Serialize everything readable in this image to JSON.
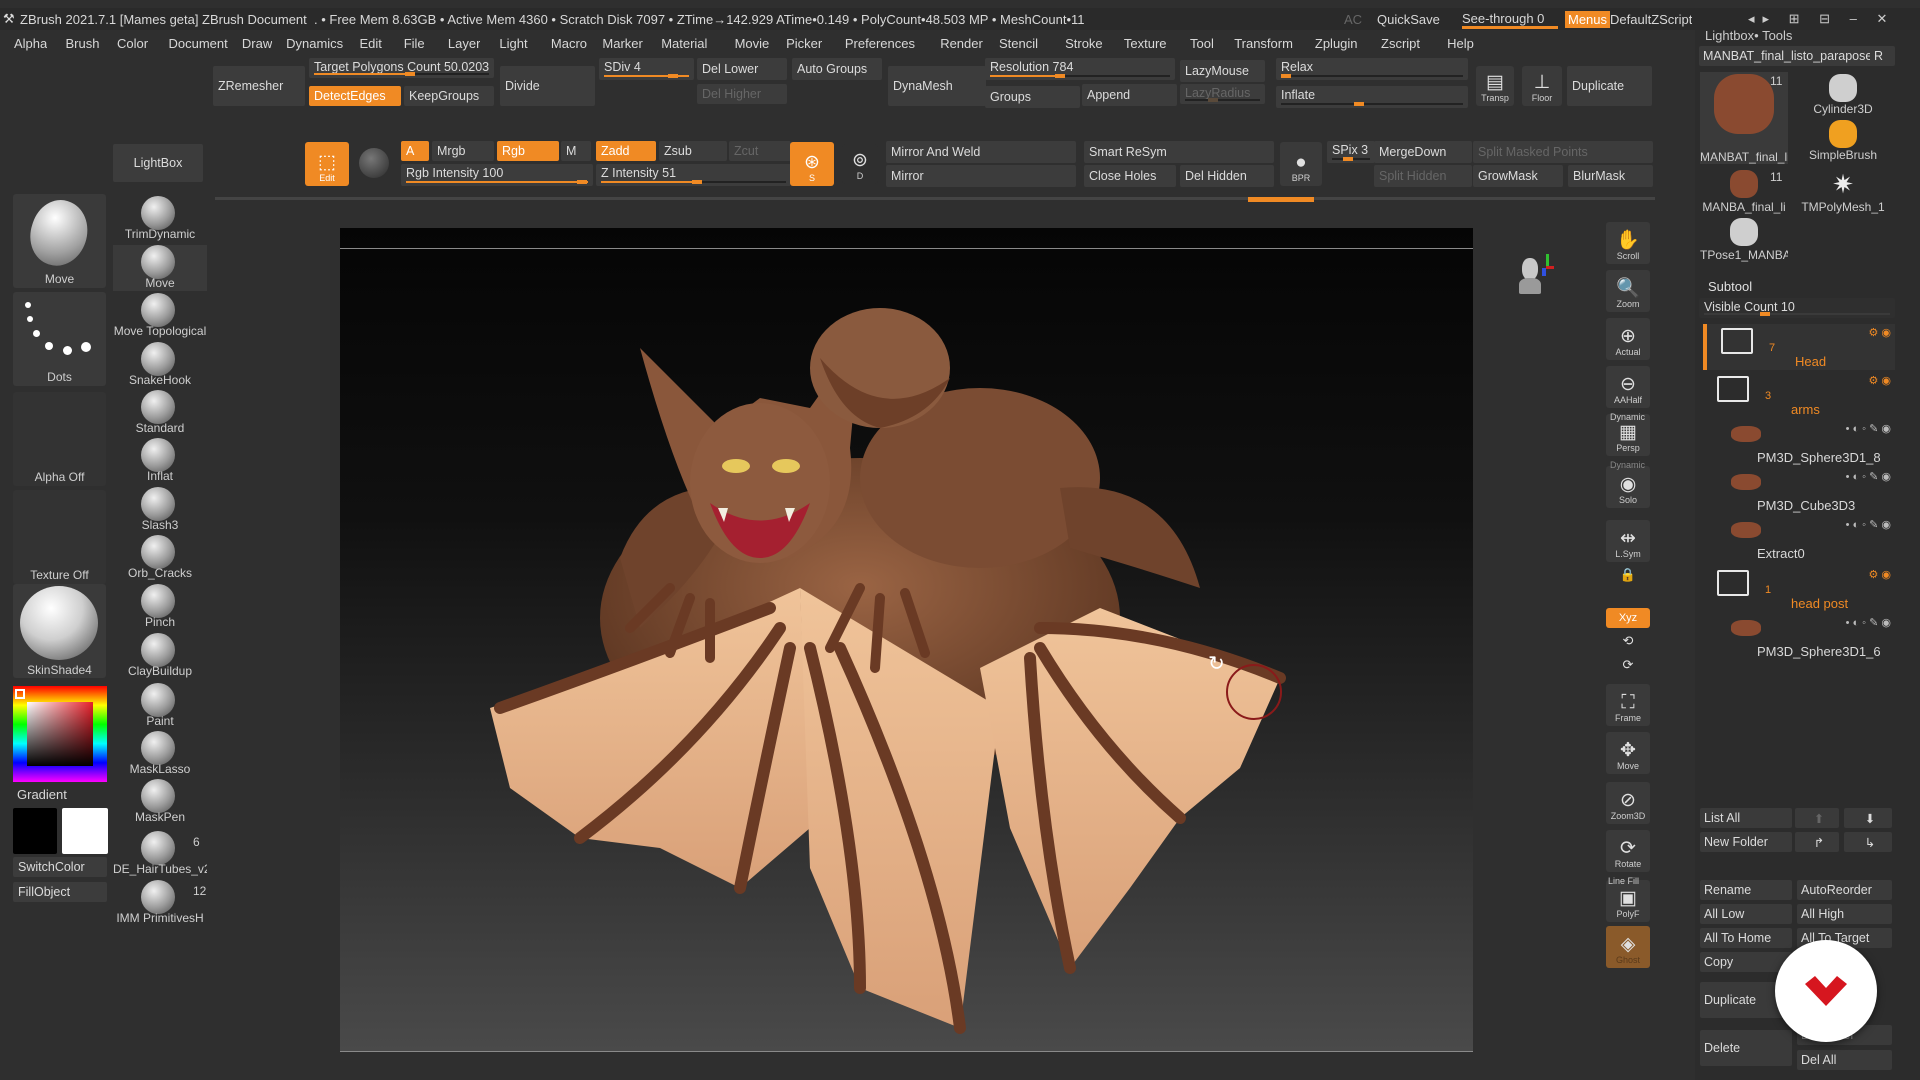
{
  "titlebar": {
    "app": "ZBrush 2021.7.1 [Mames geta]",
    "doc": "ZBrush Document",
    "stats": ". • Free Mem 8.63GB • Active Mem 4360 • Scratch Disk 7097 • ZTime→142.929 ATime•0.149 • PolyCount•48.503 MP • MeshCount•11",
    "ac": "AC",
    "quicksave": "QuickSave",
    "see_through": "See-through  0",
    "menus": "Menus",
    "script": "DefaultZScript"
  },
  "menubar": [
    "Alpha",
    "Brush",
    "Color",
    "Document",
    "Draw",
    "Dynamics",
    "Edit",
    "File",
    "Layer",
    "Light",
    "Macro",
    "Marker",
    "Material",
    "Movie",
    "Picker",
    "Preferences",
    "Render",
    "Stencil",
    "Stroke",
    "Texture",
    "Tool",
    "Transform",
    "Zplugin",
    "Zscript",
    "Help"
  ],
  "topshelf": {
    "zremesher": "ZRemesher",
    "target_polys": "Target Polygons Count 50.0203",
    "detect_edges": "DetectEdges",
    "keep_groups": "KeepGroups",
    "divide": "Divide",
    "sdiv": "SDiv 4",
    "del_lower": "Del Lower",
    "del_higher": "Del Higher",
    "auto_groups": "Auto Groups",
    "dynamesh": "DynaMesh",
    "resolution": "Resolution 784",
    "groups": "Groups",
    "lazymouse": "LazyMouse",
    "lazyradius": "LazyRadius",
    "append": "Append",
    "relax": "Relax",
    "inflate": "Inflate",
    "transp": "Transp",
    "floor": "Floor",
    "duplicate": "Duplicate"
  },
  "toolbar2": {
    "lightbox": "LightBox",
    "edit": "Edit",
    "a": "A",
    "mrgb": "Mrgb",
    "rgb": "Rgb",
    "m": "M",
    "zadd": "Zadd",
    "zsub": "Zsub",
    "zcut": "Zcut",
    "rgb_intensity": "Rgb Intensity 100",
    "z_intensity": "Z Intensity 51",
    "mirror_weld": "Mirror And Weld",
    "mirror": "Mirror",
    "smart_resym": "Smart ReSym",
    "close_holes": "Close Holes",
    "del_hidden": "Del Hidden",
    "bpr": "BPR",
    "spix": "SPix 3",
    "mergedown": "MergeDown",
    "split_masked": "Split Masked Points",
    "split_hidden": "Split Hidden",
    "growmask": "GrowMask",
    "blurmask": "BlurMask",
    "s_label": "S",
    "d_label": "D"
  },
  "leftshelf": {
    "move": "Move",
    "dots": "Dots",
    "alpha_off": "Alpha Off",
    "texture_off": "Texture Off",
    "skinshade": "SkinShade4",
    "gradient": "Gradient",
    "switchcolor": "SwitchColor",
    "fillobject": "FillObject"
  },
  "brushes": [
    {
      "label": "TrimDynamic"
    },
    {
      "label": "Move"
    },
    {
      "label": "Move Topological"
    },
    {
      "label": "SnakeHook"
    },
    {
      "label": "Standard"
    },
    {
      "label": "Inflat"
    },
    {
      "label": "Slash3"
    },
    {
      "label": "Orb_Cracks"
    },
    {
      "label": "Pinch"
    },
    {
      "label": "ClayBuildup"
    },
    {
      "label": "Paint"
    },
    {
      "label": "MaskLasso"
    },
    {
      "label": "MaskPen"
    },
    {
      "label": "DE_HairTubes_v2",
      "count": "6"
    },
    {
      "label": "IMM PrimitivesH",
      "count": "12"
    }
  ],
  "rightshelf": [
    "Scroll",
    "Zoom",
    "Actual",
    "AAHalf",
    "Persp",
    "Solo",
    "L.Sym",
    "",
    "Xyz",
    "",
    "",
    "Frame",
    "Move",
    "Zoom3D",
    "Rotate",
    "PolyF",
    "Ghost"
  ],
  "rightshelf_labels": {
    "dynamic": "Dynamic",
    "dynamic2": "Dynamic",
    "linefill": "Line Fill"
  },
  "tools": {
    "header": "Lightbox• Tools",
    "current": "MANBAT_final_listo_parapose",
    "r": "R",
    "items": [
      {
        "label": "MANBAT_final_li",
        "count": "11"
      },
      {
        "label": "Cylinder3D"
      },
      {
        "label": "SimpleBrush"
      },
      {
        "label": "MANBA_final_li",
        "count": "11"
      },
      {
        "label": "TMPolyMesh_1"
      },
      {
        "label": "TPose1_MANBA"
      }
    ]
  },
  "subtool": {
    "title": "Subtool",
    "visible_count": "Visible Count 10",
    "rows": [
      {
        "type": "folder",
        "name": "Head",
        "count": "7"
      },
      {
        "type": "folder",
        "name": "arms",
        "count": "3"
      },
      {
        "type": "mesh",
        "name": "PM3D_Sphere3D1_8"
      },
      {
        "type": "mesh",
        "name": "PM3D_Cube3D3"
      },
      {
        "type": "mesh",
        "name": "Extract0"
      },
      {
        "type": "folder",
        "name": "head post",
        "count": "1"
      },
      {
        "type": "mesh",
        "name": "PM3D_Sphere3D1_6"
      }
    ],
    "list_all": "List All",
    "new_folder": "New Folder",
    "rename": "Rename",
    "autoreorder": "AutoReorder",
    "all_low": "All Low",
    "all_high": "All High",
    "all_to_home": "All To Home",
    "all_to_target": "All To Target",
    "copy": "Copy",
    "duplicate": "Duplicate",
    "delete": "Delete",
    "del_other": "Del Other",
    "del_all": "Del All"
  },
  "colors": {
    "accent": "#f08a24",
    "bg": "#2f2f2f",
    "button": "#3c3c3c",
    "model_dark": "#7a4a30",
    "model_light": "#e8b88a",
    "logo_red": "#d6161f"
  }
}
